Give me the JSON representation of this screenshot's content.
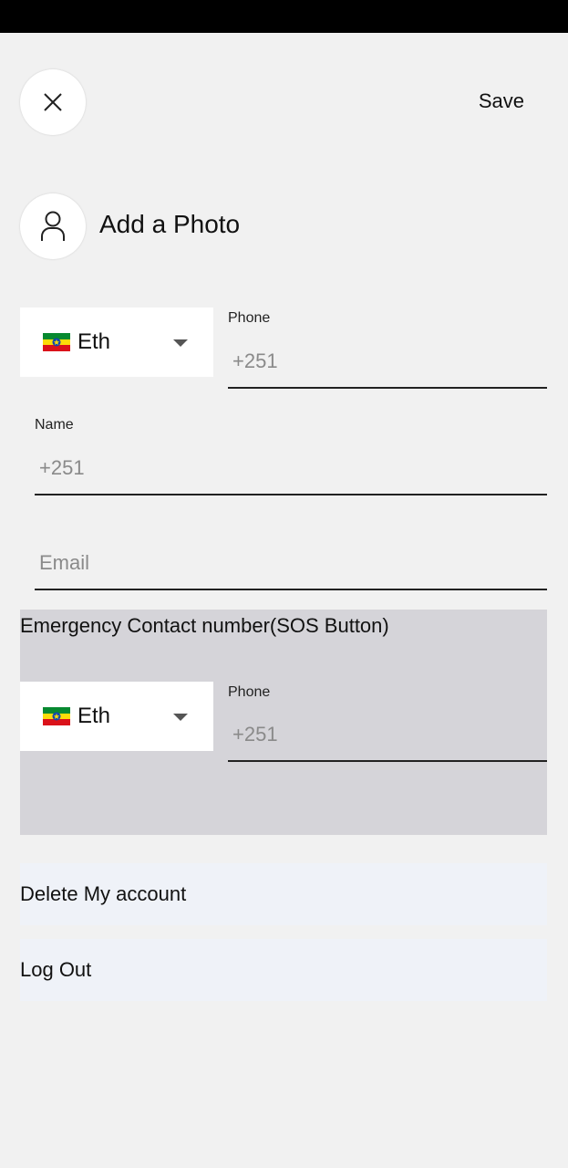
{
  "header": {
    "close_icon": "close-icon",
    "save_label": "Save"
  },
  "photo": {
    "icon": "user-icon",
    "label": "Add a Photo"
  },
  "phone": {
    "country_code": "Eth",
    "flag_icon": "ethiopia-flag-icon",
    "label": "Phone",
    "placeholder": "+251"
  },
  "name": {
    "label": "Name",
    "placeholder": "+251"
  },
  "email": {
    "placeholder": "Email"
  },
  "emergency": {
    "title": "Emergency Contact number(SOS Button)",
    "country_code": "Eth",
    "flag_icon": "ethiopia-flag-icon",
    "label": "Phone",
    "placeholder": "+251"
  },
  "actions": {
    "delete_label": "Delete My account",
    "logout_label": "Log Out"
  },
  "colors": {
    "status_bar": "#000000",
    "background": "#f1f1f1",
    "sos_panel": "#d5d4d9",
    "action_row": "#eff2f8",
    "flag_green": "#078930",
    "flag_yellow": "#fcdd09",
    "flag_red": "#da121a",
    "flag_emblem": "#0f47af"
  }
}
